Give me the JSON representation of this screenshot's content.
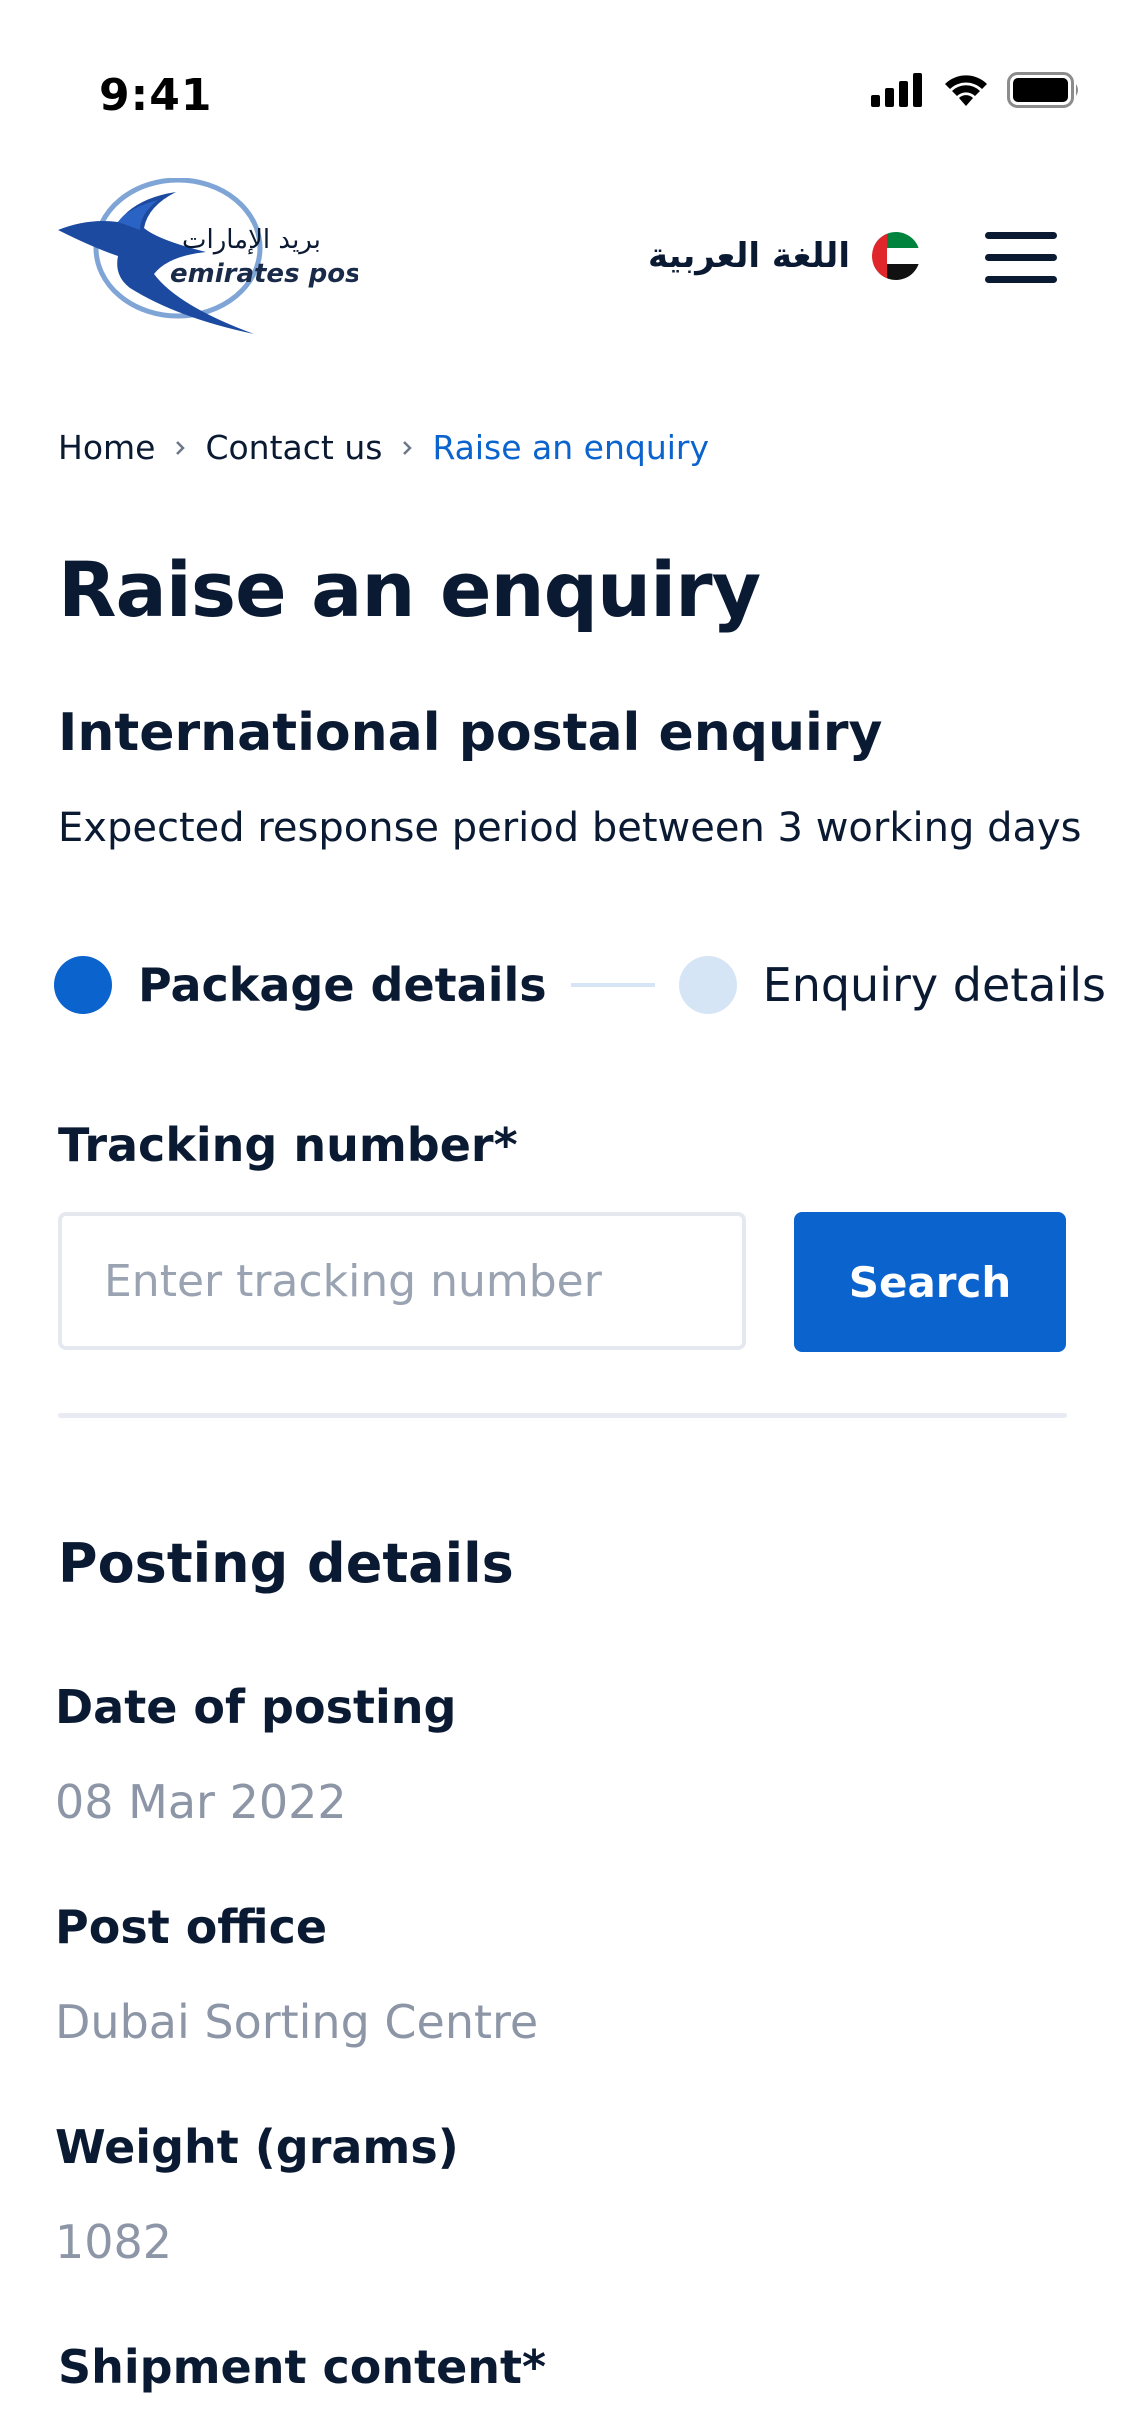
{
  "status_bar": {
    "time": "9:41"
  },
  "header": {
    "logo_arabic": "بريد الإمارات",
    "logo_english": "emirates post",
    "language_label": "اللغة العربية"
  },
  "breadcrumb": {
    "items": [
      "Home",
      "Contact us",
      "Raise an enquiry"
    ]
  },
  "page": {
    "title": "Raise an enquiry",
    "section_title": "International postal enquiry",
    "subtext": "Expected response period between 3 working days"
  },
  "stepper": {
    "steps": [
      "Package details",
      "Enquiry details"
    ],
    "active_step": 1
  },
  "tracking": {
    "label": "Tracking number*",
    "placeholder": "Enter tracking number",
    "value": "",
    "search_label": "Search"
  },
  "posting": {
    "title": "Posting details",
    "fields": [
      {
        "label": "Date of posting",
        "value": "08 Mar 2022"
      },
      {
        "label": "Post office",
        "value": "Dubai Sorting Centre"
      },
      {
        "label": "Weight (grams)",
        "value": "1082"
      }
    ],
    "shipment_label": "Shipment content*"
  },
  "colors": {
    "primary": "#0b63ce",
    "text_dark": "#0b1a33",
    "muted": "#8d96a6",
    "step_inactive": "#d6e5f5"
  }
}
